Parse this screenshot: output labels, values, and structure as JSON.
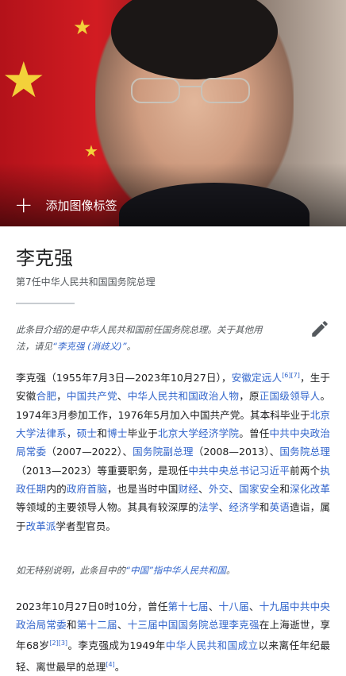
{
  "hero": {
    "add_caption": "添加图像标签"
  },
  "article": {
    "title": "李克强",
    "subtitle": "第7任中华人民共和国国务院总理",
    "hatnote": {
      "text": "此条目介绍的是中华人民共和国前任国务院总理。关于其他用法，请见",
      "link": "“李克强 (消歧义)”",
      "end": "。"
    },
    "paragraph1": [
      {
        "t": "李克强（1955年7月3日—2023年10月27日），"
      },
      {
        "a": "安徽定远人"
      },
      {
        "s": "[6]"
      },
      {
        "s": "[7]"
      },
      {
        "t": "，生于安徽"
      },
      {
        "a": "合肥"
      },
      {
        "t": "，"
      },
      {
        "a": "中国共产党"
      },
      {
        "t": "、"
      },
      {
        "a": "中华人民共和国政治人物"
      },
      {
        "t": "，原"
      },
      {
        "a": "正国级领导人"
      },
      {
        "t": "。1974年3月参加工作，1976年5月加入中国共产党。其本科毕业于"
      },
      {
        "a": "北京大学法律系"
      },
      {
        "t": "，"
      },
      {
        "a": "硕士"
      },
      {
        "t": "和"
      },
      {
        "a": "博士"
      },
      {
        "t": "毕业于"
      },
      {
        "a": "北京大学经济学院"
      },
      {
        "t": "。曾任"
      },
      {
        "a": "中共中央政治局常委"
      },
      {
        "t": "（2007—2022）、"
      },
      {
        "a": "国务院副总理"
      },
      {
        "t": "（2008—2013）、"
      },
      {
        "a": "国务院总理"
      },
      {
        "t": "（2013—2023）等重要职务，是现任"
      },
      {
        "a": "中共中央总书记习近平"
      },
      {
        "t": "前两个"
      },
      {
        "a": "执政任期"
      },
      {
        "t": "内的"
      },
      {
        "a": "政府首脑"
      },
      {
        "t": "，也是当时中国"
      },
      {
        "a": "财经"
      },
      {
        "t": "、"
      },
      {
        "a": "外交"
      },
      {
        "t": "、"
      },
      {
        "a": "国家安全"
      },
      {
        "t": "和"
      },
      {
        "a": "深化改革"
      },
      {
        "t": "等领域的主要领导人物。其具有较深厚的"
      },
      {
        "a": "法学"
      },
      {
        "t": "、"
      },
      {
        "a": "经济学"
      },
      {
        "t": "和"
      },
      {
        "a": "英语"
      },
      {
        "t": "造诣，属于"
      },
      {
        "a": "改革派"
      },
      {
        "t": "学者型官员。"
      }
    ],
    "note": {
      "before": "如无特别说明，此条目中的",
      "link": "“中国”指中华人民共和国",
      "after": "。"
    },
    "paragraph2": [
      {
        "t": "2023年10月27日0时10分，曾任"
      },
      {
        "a": "第十七届"
      },
      {
        "t": "、"
      },
      {
        "a": "十八届"
      },
      {
        "t": "、"
      },
      {
        "a": "十九届中共中央政治局常委"
      },
      {
        "t": "和"
      },
      {
        "a": "第十二届"
      },
      {
        "t": "、"
      },
      {
        "a": "十三届中国国务院总理李克强"
      },
      {
        "t": "在上海逝世，享年68岁"
      },
      {
        "s": "[2]"
      },
      {
        "s": "[3]"
      },
      {
        "t": "。李克强成为1949年"
      },
      {
        "a": "中华人民共和国成立"
      },
      {
        "t": "以来离任年纪最轻、离世最早的总理"
      },
      {
        "s": "[4]"
      },
      {
        "t": "。"
      }
    ]
  },
  "colors": {
    "link": "#3366cc",
    "text": "#202122",
    "muted": "#54595d"
  }
}
